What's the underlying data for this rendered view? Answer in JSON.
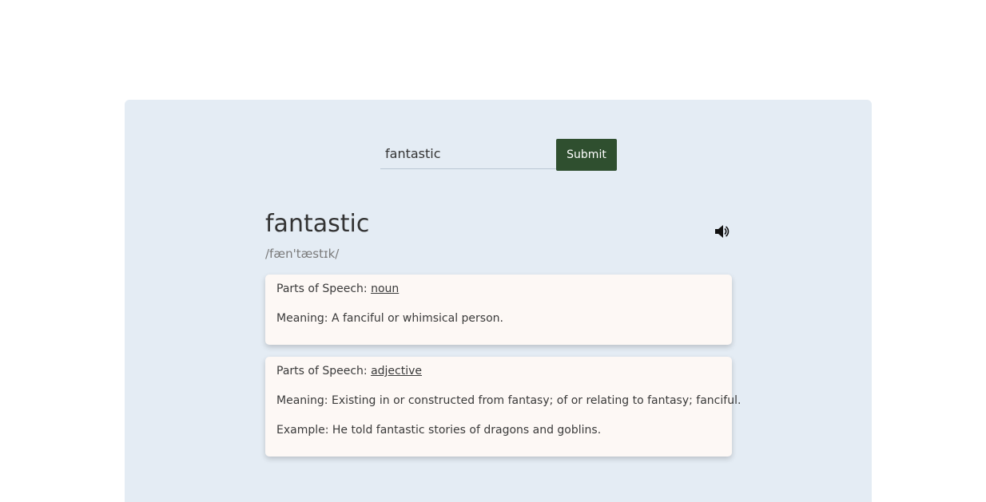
{
  "search": {
    "value": "fantastic",
    "submit_label": "Submit"
  },
  "entry": {
    "word": "fantastic",
    "phonetic": "/fæn'tæstɪk/",
    "audio_icon": "speaker-icon",
    "meanings": [
      {
        "pos_label": "Parts of Speech: ",
        "pos": "noun",
        "meaning_label": "Meaning: ",
        "definition": "A fanciful or whimsical person."
      },
      {
        "pos_label": "Parts of Speech: ",
        "pos": "adjective",
        "meaning_label": "Meaning: ",
        "definition": "Existing in or constructed from fantasy; of or relating to fantasy; fanciful.",
        "example_label": "Example: ",
        "example": "He told fantastic stories of dragons and goblins."
      }
    ]
  },
  "colors": {
    "panel_bg": "#e4ecf4",
    "button_bg": "#2f4f2f",
    "card_bg": "#fdf8f5"
  }
}
